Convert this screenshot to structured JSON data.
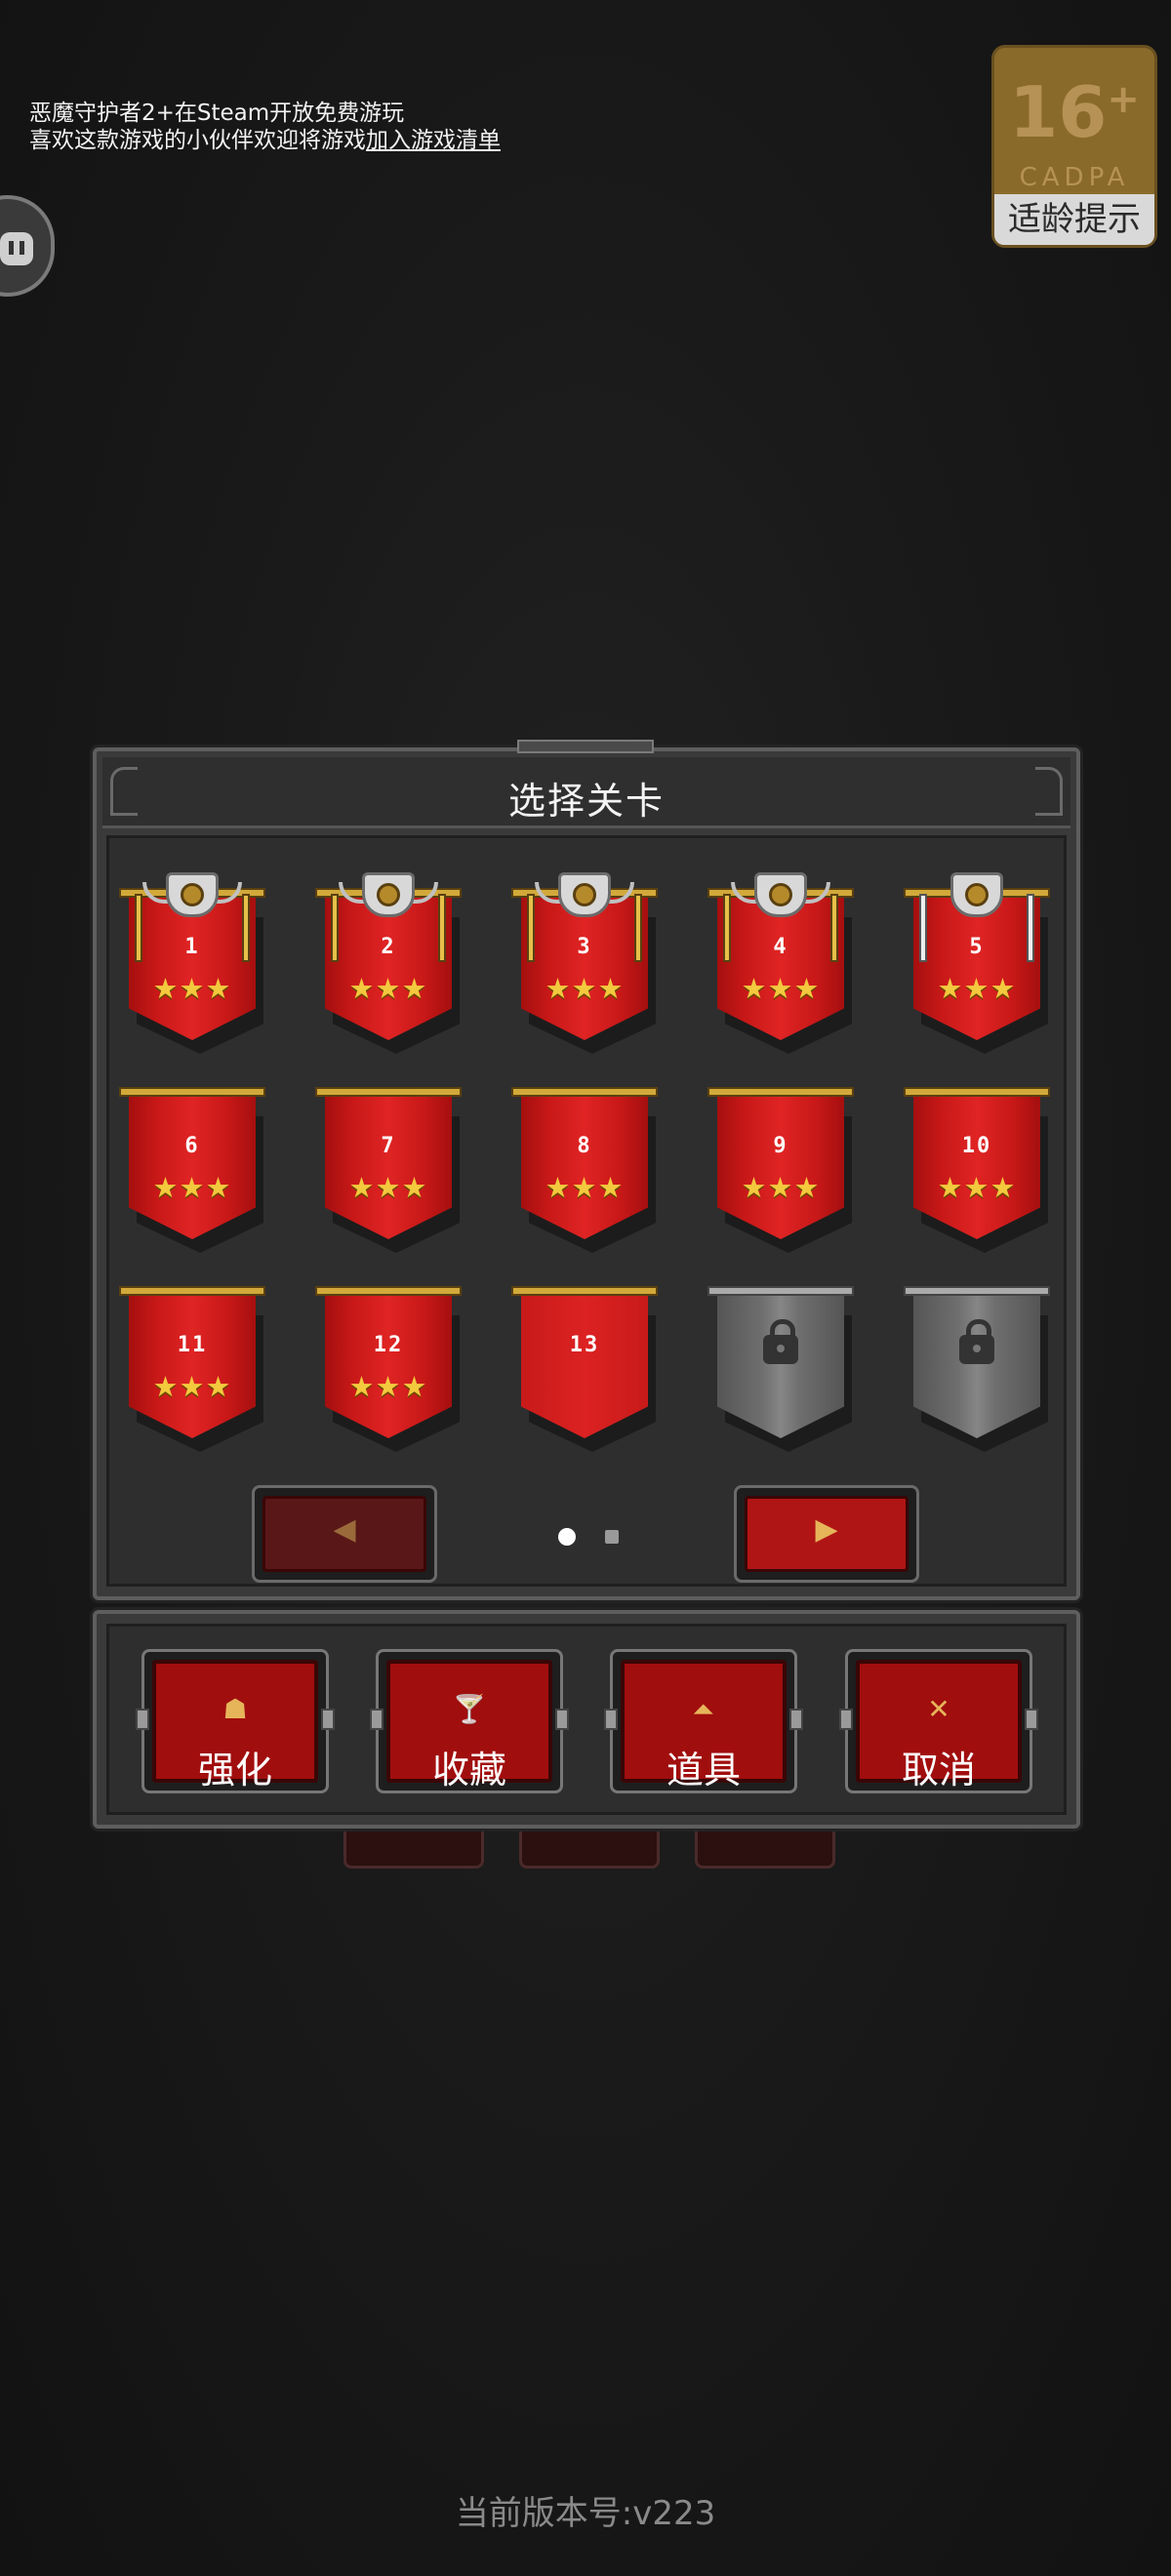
{
  "notice": {
    "line1": "恶魔守护者2+在Steam开放免费游玩",
    "line2_prefix": "喜欢这款游戏的小伙伴欢迎将游戏",
    "line2_link": "加入游戏清单"
  },
  "age_rating": {
    "number": "16",
    "plus": "+",
    "org": "CADPA",
    "tip": "适龄提示"
  },
  "panel": {
    "title": "选择关卡"
  },
  "levels": [
    {
      "label": "1",
      "stars": "★★★",
      "state": "boss"
    },
    {
      "label": "2",
      "stars": "★★★",
      "state": "boss"
    },
    {
      "label": "3",
      "stars": "★★★",
      "state": "boss"
    },
    {
      "label": "4",
      "stars": "★★★",
      "state": "boss"
    },
    {
      "label": "5",
      "stars": "★★★",
      "state": "boss-silver"
    },
    {
      "label": "6",
      "stars": "★★★",
      "state": "cleared"
    },
    {
      "label": "7",
      "stars": "★★★",
      "state": "cleared"
    },
    {
      "label": "8",
      "stars": "★★★",
      "state": "cleared"
    },
    {
      "label": "9",
      "stars": "★★★",
      "state": "cleared"
    },
    {
      "label": "10",
      "stars": "★★★",
      "state": "cleared"
    },
    {
      "label": "11",
      "stars": "★★★",
      "state": "cleared"
    },
    {
      "label": "12",
      "stars": "★★★",
      "state": "cleared"
    },
    {
      "label": "13",
      "stars": "",
      "state": "current"
    },
    {
      "label": "",
      "stars": "",
      "state": "locked"
    },
    {
      "label": "",
      "stars": "",
      "state": "locked"
    }
  ],
  "pager": {
    "prev": "◀",
    "next": "▶",
    "page": 1,
    "pages": 2
  },
  "actions": {
    "upgrade": {
      "label": "强化",
      "icon": "☗"
    },
    "collection": {
      "label": "收藏",
      "icon": "🍸"
    },
    "items": {
      "label": "道具",
      "icon": "⏶"
    },
    "cancel": {
      "label": "取消",
      "icon": "✕"
    }
  },
  "version": "当前版本号:v223",
  "colors": {
    "banner_red": "#e02424",
    "star_gold": "#f3c93e",
    "locked_gray": "#6e6e6e"
  }
}
